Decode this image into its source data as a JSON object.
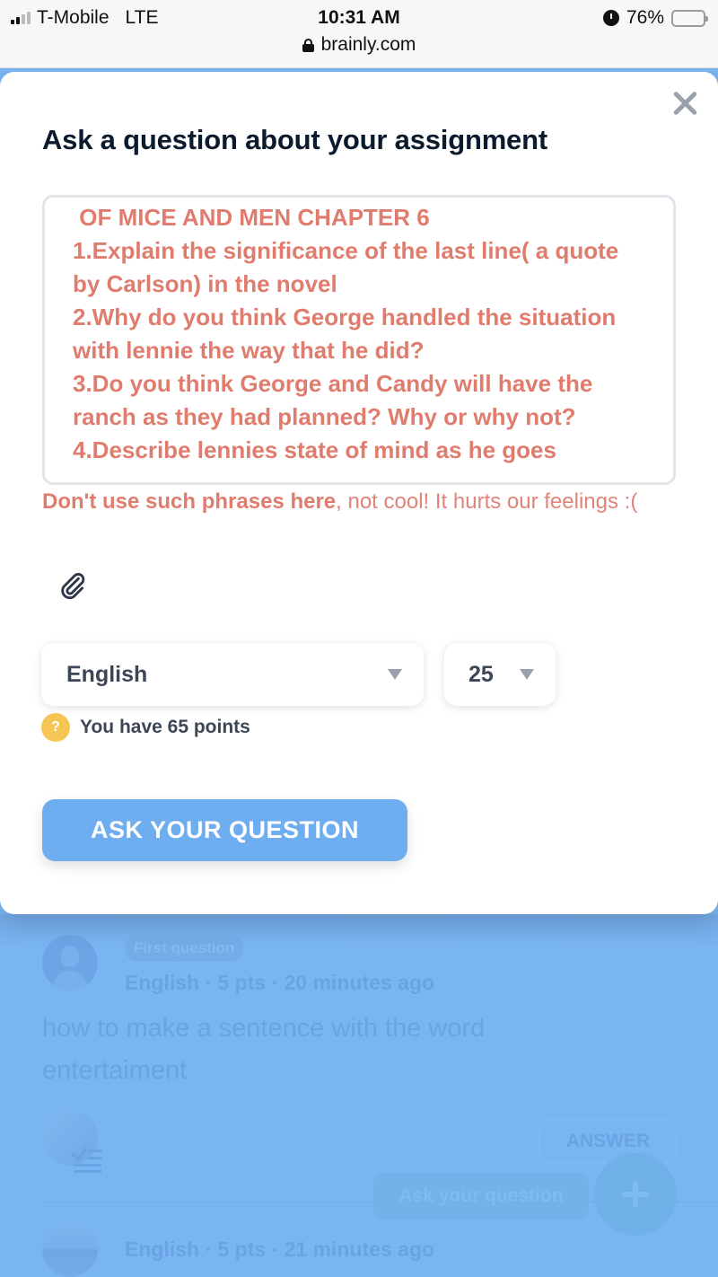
{
  "status_bar": {
    "carrier": "T-Mobile",
    "network": "LTE",
    "time": "10:31 AM",
    "battery": "76%",
    "battery_level": 0.76,
    "url": "brainly.com"
  },
  "modal": {
    "title": "Ask a question about your assignment",
    "question_text": " OF MICE AND MEN CHAPTER 6\n1.Explain the significance of the last line( a quote by Carlson) in the novel\n2.Why do you think George handled the situation with lennie the way that he did?\n3.Do you think George and Candy will have the ranch as they had planned? Why or why not?\n4.Describe lennies state of mind as he goes",
    "warning_bold": "Don't use such phrases here",
    "warning_rest": ", not cool! It hurts our feelings :(",
    "subject_select": {
      "value": "English"
    },
    "points_select": {
      "value": "25"
    },
    "points_info": "You have 65 points",
    "help_glyph": "?",
    "submit_label": "ASK YOUR QUESTION"
  },
  "feed": {
    "items": [
      {
        "badge": "First question",
        "meta": "English · 5 pts · 20 minutes ago",
        "content": "how to make a sentence with the word entertaiment"
      },
      {
        "meta": "English · 5 pts · 21 minutes ago"
      }
    ],
    "answer_label": "ANSWER",
    "ask_label": "Ask your question",
    "fab_glyph": "+"
  },
  "colors": {
    "accent": "#6eaef0",
    "error_text": "#e07c6e",
    "help_badge": "#f5c653",
    "overlay": "#7ab5f3"
  }
}
